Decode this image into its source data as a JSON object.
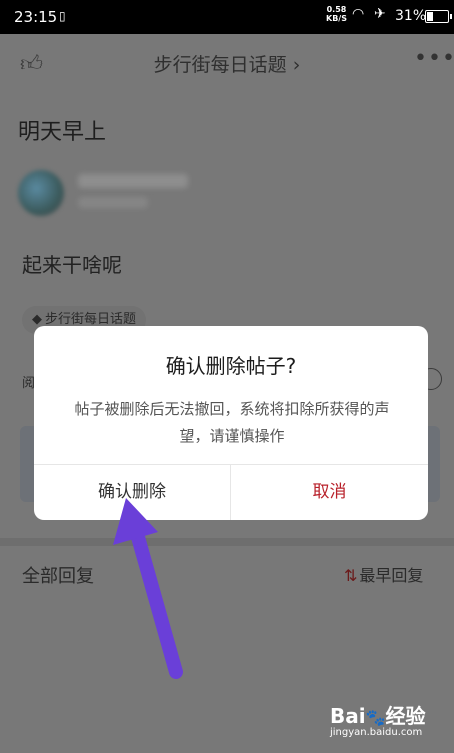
{
  "status_bar": {
    "time": "23:15",
    "net_speed_value": "0.58",
    "net_speed_unit": "KB/S",
    "battery_text": "31%",
    "battery_level": 0.31
  },
  "header": {
    "topic": "步行街每日话题",
    "topic_chevron": "›",
    "more": "•••"
  },
  "post": {
    "title": "明天早上",
    "body": "起来干啥呢",
    "tag_label": "步行街每日话题",
    "read_stub": "阅"
  },
  "replies": {
    "label": "全部回复",
    "sort_label": "最早回复"
  },
  "dialog": {
    "title": "确认删除帖子?",
    "message": "帖子被删除后无法撤回，系统将扣除所获得的声望，请谨慎操作",
    "confirm_label": "确认删除",
    "cancel_label": "取消",
    "cancel_color": "#b8202a"
  },
  "annotation": {
    "arrow_color": "#6a3fd8"
  },
  "watermark": {
    "brand": "Bai",
    "brand_suffix": "经验",
    "url": "jingyan.baidu.com"
  }
}
